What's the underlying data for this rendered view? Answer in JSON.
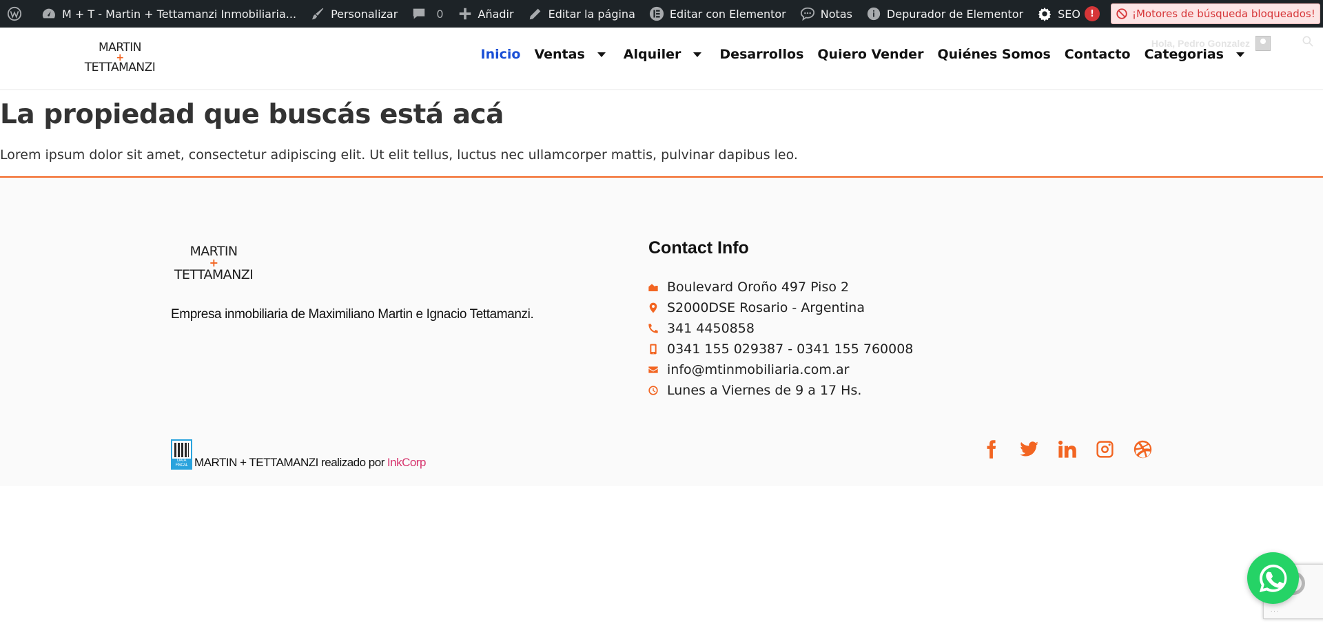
{
  "adminbar": {
    "site_name": "M + T - Martin + Tettamanzi Inmobiliaria...",
    "customize": "Personalizar",
    "comments_count": "0",
    "add_new": "Añadir",
    "edit_page": "Editar la página",
    "edit_elementor": "Editar con Elementor",
    "notes": "Notas",
    "debugger": "Depurador de Elementor",
    "seo": "SEO",
    "seo_alert": "!",
    "search_blocked": "¡Motores de búsqueda bloqueados!"
  },
  "header": {
    "logo_top": "MARTIN",
    "logo_plus": "+",
    "logo_bottom": "TETTAMANZI",
    "greeting": "Hola, Pedro Gonzalez",
    "nav": [
      {
        "label": "Inicio"
      },
      {
        "label": "Ventas"
      },
      {
        "label": "Alquiler"
      },
      {
        "label": "Desarrollos"
      },
      {
        "label": "Quiero Vender"
      },
      {
        "label": "Quiénes Somos"
      },
      {
        "label": "Contacto"
      },
      {
        "label": "Categorias"
      }
    ]
  },
  "main": {
    "title": "La propiedad que buscás está acá",
    "text": "Lorem ipsum dolor sit amet, consectetur adipiscing elit. Ut elit tellus, luctus nec ullamcorper mattis, pulvinar dapibus leo."
  },
  "footer": {
    "logo_top": "MARTIN",
    "logo_plus": "+",
    "logo_bottom": "TETTAMANZI",
    "description": "Empresa inmobiliaria de Maximiliano Martin e Ignacio Tettamanzi.",
    "contact_title": "Contact Info",
    "contact": [
      {
        "icon": "building-icon",
        "text": "Boulevard Oroño 497 Piso 2"
      },
      {
        "icon": "map-pin-icon",
        "text": "S2000DSE Rosario - Argentina"
      },
      {
        "icon": "phone-icon",
        "text": "341 4450858"
      },
      {
        "icon": "mobile-icon",
        "text": "0341 155 029387 - 0341 155 760008"
      },
      {
        "icon": "envelope-icon",
        "text": "info@mtinmobiliaria.com.ar"
      },
      {
        "icon": "clock-icon",
        "text": "Lunes a Viernes de 9 a 17 Hs."
      }
    ],
    "credits_text": "MARTIN + TETTAMANZI realizado por",
    "credits_link": "InkCorp",
    "qr_label": "DATA FISCAL",
    "socials": [
      "facebook-icon",
      "twitter-icon",
      "linkedin-icon",
      "instagram-icon",
      "dribbble-icon"
    ]
  },
  "colors": {
    "accent": "#f26522",
    "nav_active": "#1a4fd6",
    "adminbar_bg": "#1d2327",
    "whatsapp": "#25d366",
    "credits_link": "#d6336c"
  }
}
